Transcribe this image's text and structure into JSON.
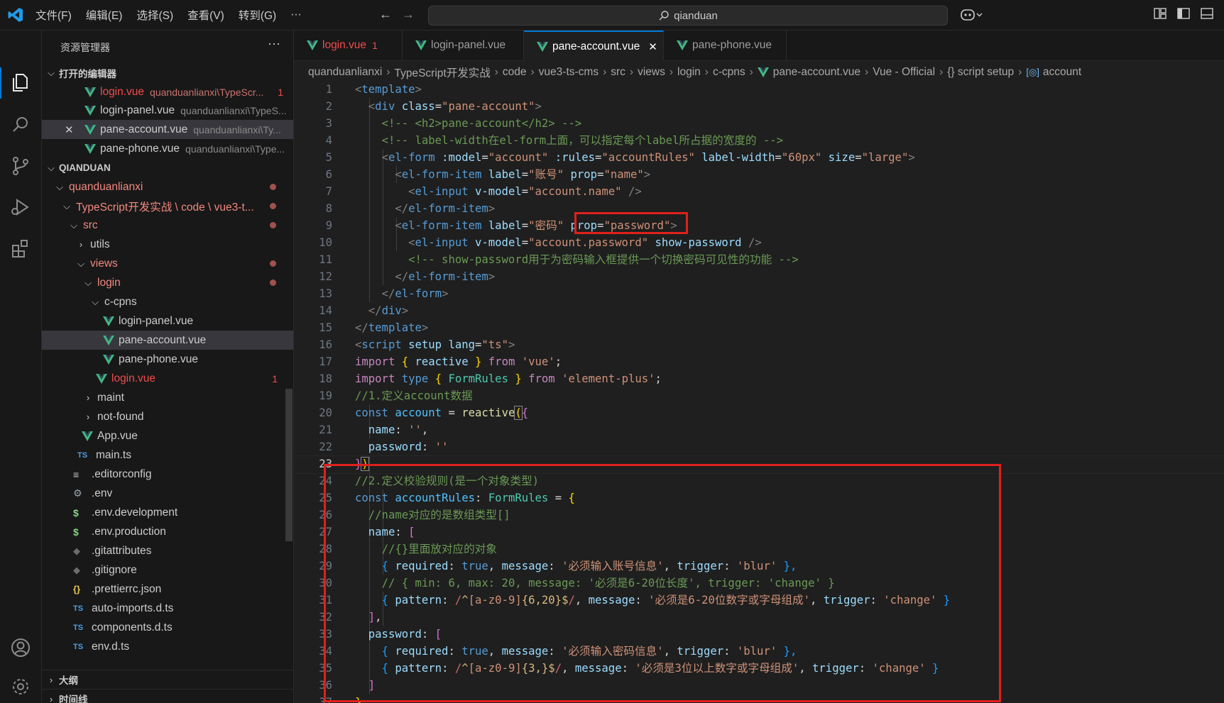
{
  "menu": [
    "文件(F)",
    "编辑(E)",
    "选择(S)",
    "查看(V)",
    "转到(G)",
    "···"
  ],
  "search": {
    "text": "qianduan"
  },
  "explorer": {
    "title": "资源管理器",
    "more": "···",
    "open_editors_title": "打开的编辑器",
    "open_editors": [
      {
        "name": "login.vue",
        "path": "quanduanlianxi\\TypeScr...",
        "badge": "1"
      },
      {
        "name": "login-panel.vue",
        "path": "quanduanlianxi\\TypeS..."
      },
      {
        "name": "pane-account.vue",
        "path": "quanduanlianxi\\Ty..."
      },
      {
        "name": "pane-phone.vue",
        "path": "quanduanlianxi\\Type..."
      }
    ],
    "workspace_title": "QIANDUAN",
    "tree": [
      {
        "label": "quanduanlianxi"
      },
      {
        "label": "TypeScript开发实战 \\ code \\ vue3-t..."
      },
      {
        "label": "src"
      },
      {
        "label": "utils"
      },
      {
        "label": "views"
      },
      {
        "label": "login"
      },
      {
        "label": "c-cpns"
      },
      {
        "label": "login-panel.vue"
      },
      {
        "label": "pane-account.vue"
      },
      {
        "label": "pane-phone.vue"
      },
      {
        "label": "login.vue",
        "badge": "1"
      },
      {
        "label": "maint"
      },
      {
        "label": "not-found"
      },
      {
        "label": "App.vue"
      },
      {
        "label": "main.ts",
        "icon_text": "TS"
      },
      {
        "label": ".editorconfig"
      },
      {
        "label": ".env"
      },
      {
        "label": ".env.development",
        "icon_text": "$"
      },
      {
        "label": ".env.production",
        "icon_text": "$"
      },
      {
        "label": ".gitattributes"
      },
      {
        "label": ".gitignore"
      },
      {
        "label": ".prettierrc.json",
        "icon_text": "{}"
      },
      {
        "label": "auto-imports.d.ts",
        "icon_text": "TS"
      },
      {
        "label": "components.d.ts",
        "icon_text": "TS"
      },
      {
        "label": "env.d.ts",
        "icon_text": "TS"
      }
    ],
    "outline_title": "大纲",
    "timeline_title": "时间线"
  },
  "tabs": [
    {
      "label": "login.vue",
      "badge": "1"
    },
    {
      "label": "login-panel.vue"
    },
    {
      "label": "pane-account.vue",
      "close": "✕"
    },
    {
      "label": "pane-phone.vue"
    }
  ],
  "breadcrumb": [
    "quanduanlianxi",
    "TypeScript开发实战",
    "code",
    "vue3-ts-cms",
    "src",
    "views",
    "login",
    "c-cpns",
    "pane-account.vue",
    "Vue - Official",
    "{} script setup",
    "account"
  ],
  "editor": {
    "current_line": "23",
    "line_numbers": [
      "1",
      "2",
      "3",
      "4",
      "5",
      "6",
      "7",
      "8",
      "9",
      "10",
      "11",
      "12",
      "13",
      "14",
      "15",
      "16",
      "17",
      "18",
      "19",
      "20",
      "21",
      "22",
      "23",
      "24",
      "25",
      "26",
      "27",
      "28",
      "29",
      "30",
      "31",
      "32",
      "33",
      "34",
      "35",
      "36",
      "37"
    ],
    "tokens": {
      "l1": [
        "<",
        "template",
        ">"
      ],
      "l2": [
        "<",
        "div",
        "class",
        "=",
        "\"pane-account\"",
        ">"
      ],
      "l3": "<!-- <h2>pane-account</h2> -->",
      "l4": "<!-- label-width在el-form上面，可以指定每个label所占据的宽度的 -->",
      "l5": [
        "<",
        "el-form",
        ":model",
        "=",
        "\"account\"",
        ":rules",
        "=",
        "\"accountRules\"",
        "label-width",
        "=",
        "\"60px\"",
        "size",
        "=",
        "\"large\"",
        ">"
      ],
      "l6": [
        "<",
        "el-form-item",
        "label",
        "=",
        "\"账号\"",
        "prop",
        "=",
        "\"name\"",
        ">"
      ],
      "l7": [
        "<",
        "el-input",
        "v-model",
        "=",
        "\"account.name\"",
        "/>"
      ],
      "l8": [
        "</",
        "el-form-item",
        ">"
      ],
      "l9": [
        "<",
        "el-form-item",
        "label",
        "=",
        "\"密码\"",
        "prop",
        "=",
        "\"password\"",
        ">"
      ],
      "l10": [
        "<",
        "el-input",
        "v-model",
        "=",
        "\"account.password\"",
        "show-password",
        "/>"
      ],
      "l11": "<!-- show-password用于为密码输入框提供一个切换密码可见性的功能 -->",
      "l12": [
        "</",
        "el-form-item",
        ">"
      ],
      "l13": [
        "</",
        "el-form",
        ">"
      ],
      "l14": [
        "</",
        "div",
        ">"
      ],
      "l15": [
        "</",
        "template",
        ">"
      ],
      "l16": [
        "<",
        "script",
        "setup",
        "lang",
        "=",
        "\"ts\"",
        ">"
      ],
      "l17": [
        "import",
        "{",
        "reactive",
        "}",
        "from",
        "'vue'",
        ";"
      ],
      "l18": [
        "import",
        "type",
        "{",
        "FormRules",
        "}",
        "from",
        "'element-plus'",
        ";"
      ],
      "l19": "//1.定义account数据",
      "l20": [
        "const",
        "account",
        "=",
        "reactive",
        "(",
        "{"
      ],
      "l21": [
        "name",
        ":",
        "''",
        ","
      ],
      "l22": [
        "password",
        ":",
        "''"
      ],
      "l23": [
        "}",
        ")"
      ],
      "l24": "//2.定义校验规则(是一个对象类型)",
      "l25": [
        "const",
        "accountRules",
        ":",
        "FormRules",
        "=",
        "{"
      ],
      "l26": "//name对应的是数组类型[]",
      "l27": [
        "name",
        ":",
        "["
      ],
      "l28": "//{}里面放对应的对象",
      "l29": [
        "{",
        "required",
        ":",
        "true",
        ",",
        "message",
        ":",
        "'必须输入账号信息'",
        ",",
        "trigger",
        ":",
        "'blur'",
        "},"
      ],
      "l30": "// { min: 6, max: 20, message: '必须是6-20位长度', trigger: 'change' }",
      "l31": [
        "{",
        "pattern",
        ":",
        "/",
        "^",
        "[a-z0-9]",
        "{6,20}",
        "$",
        "/",
        ",",
        "message",
        ":",
        "'必须是6-20位数字或字母组成'",
        ",",
        "trigger",
        ":",
        "'change'",
        "}"
      ],
      "l32": [
        "]",
        ","
      ],
      "l33": [
        "password",
        ":",
        "["
      ],
      "l34": [
        "{",
        "required",
        ":",
        "true",
        ",",
        "message",
        ":",
        "'必须输入密码信息'",
        ",",
        "trigger",
        ":",
        "'blur'",
        "},"
      ],
      "l35": [
        "{",
        "pattern",
        ":",
        "/",
        "^",
        "[a-z0-9]",
        "{3,}",
        "$",
        "/",
        ",",
        "message",
        ":",
        "'必须是3位以上数字或字母组成'",
        ",",
        "trigger",
        ":",
        "'change'",
        "}"
      ],
      "l36": [
        "]"
      ],
      "l37": [
        "}"
      ]
    }
  },
  "colors": {
    "accent": "#0078d4",
    "highlight_box": "#e0201c",
    "vue_green": "#41b883"
  }
}
